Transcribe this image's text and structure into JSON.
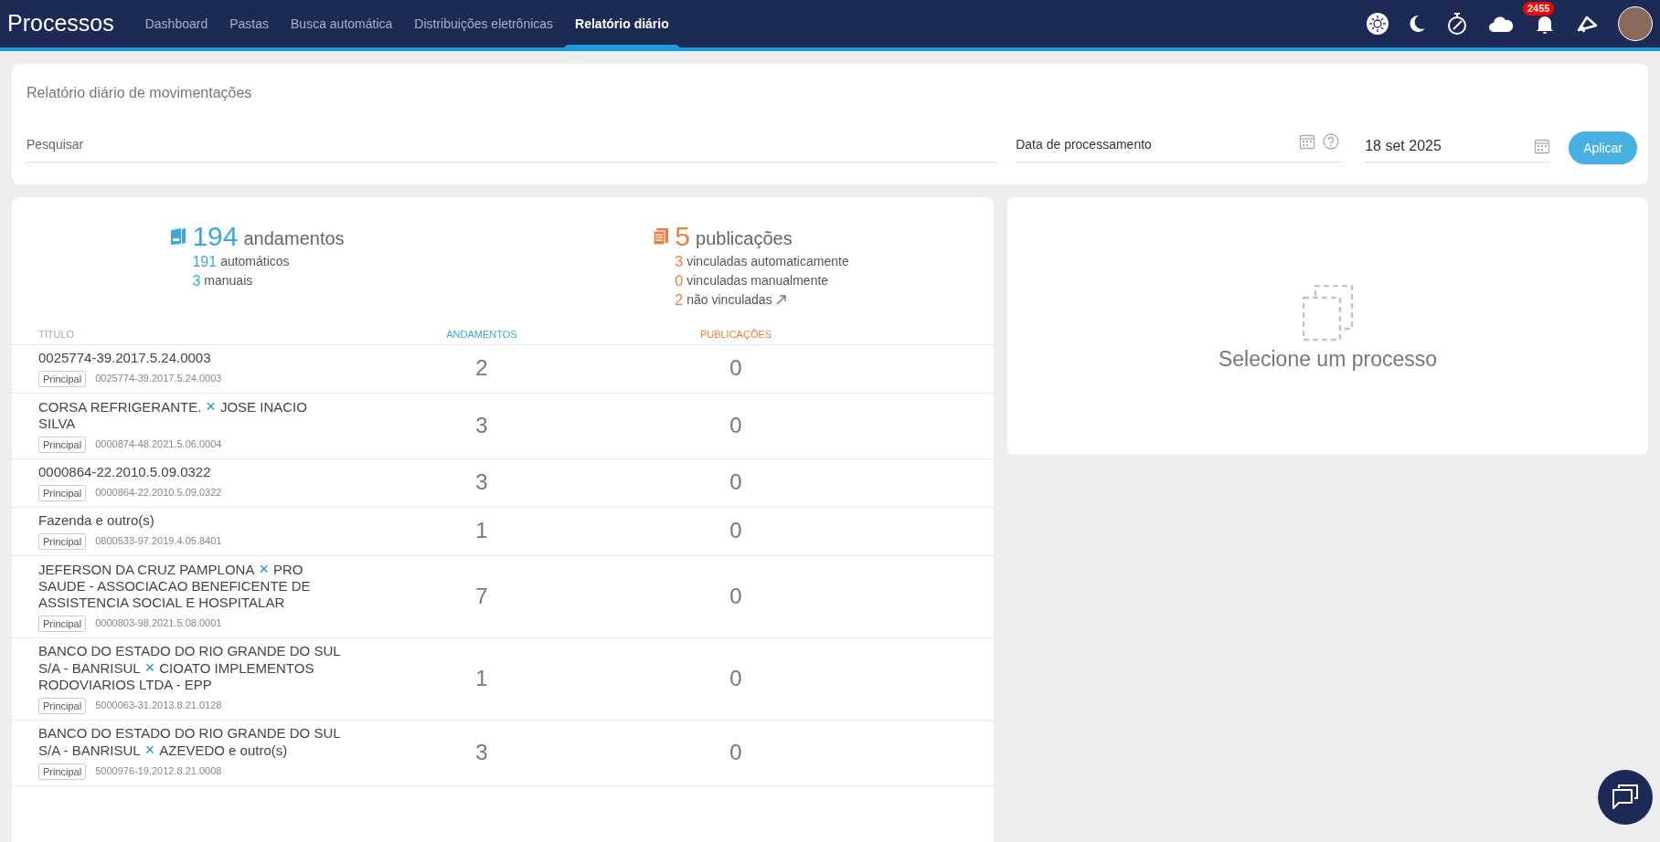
{
  "app_title": "Processos",
  "nav": [
    {
      "label": "Dashboard",
      "selected": false
    },
    {
      "label": "Pastas",
      "selected": false
    },
    {
      "label": "Busca automática",
      "selected": false
    },
    {
      "label": "Distribuições eletrônicas",
      "selected": false
    },
    {
      "label": "Relatório diário",
      "selected": true
    }
  ],
  "notifications_badge": "2455",
  "report": {
    "title": "Relatório diário de movimentações",
    "search": {
      "placeholder": "Pesquisar"
    },
    "date_field": {
      "placeholder": "Data de processamento"
    },
    "date_value": "18 set 2025",
    "apply_button": "Aplicar"
  },
  "summary": {
    "andamentos": {
      "count": "194",
      "label": "andamentos",
      "lines": [
        {
          "count": "191",
          "label": "automáticos"
        },
        {
          "count": "3",
          "label": "manuais"
        }
      ]
    },
    "publicacoes": {
      "count": "5",
      "label": "publicações",
      "lines": [
        {
          "count": "3",
          "label": "vinculadas automaticamente",
          "link": false
        },
        {
          "count": "0",
          "label": "vinculadas manualmente",
          "link": false
        },
        {
          "count": "2",
          "label": "não vinculadas",
          "link": true
        }
      ]
    }
  },
  "table": {
    "columns": [
      "TÍTULO",
      "ANDAMENTOS",
      "PUBLICAÇÕES"
    ],
    "separator": "×",
    "rows": [
      {
        "parties": [
          "0025774-39.2017.5.24.0003"
        ],
        "tag": "Principal",
        "number": "0025774-39.2017.5.24.0003",
        "andamentos": "2",
        "publicacoes": "0"
      },
      {
        "parties": [
          "CORSA REFRIGERANTE.",
          "JOSE INACIO SILVA"
        ],
        "tag": "Principal",
        "number": "0000874-48.2021.5.06.0004",
        "andamentos": "3",
        "publicacoes": "0"
      },
      {
        "parties": [
          "0000864-22.2010.5.09.0322"
        ],
        "tag": "Principal",
        "number": "0000864-22.2010.5.09.0322",
        "andamentos": "3",
        "publicacoes": "0"
      },
      {
        "parties": [
          "Fazenda e outro(s)"
        ],
        "tag": "Principal",
        "number": "0800533-97.2019.4.05.8401",
        "andamentos": "1",
        "publicacoes": "0"
      },
      {
        "parties": [
          "JEFERSON DA CRUZ PAMPLONA",
          "PRO SAUDE - ASSOCIACAO BENEFICENTE DE ASSISTENCIA SOCIAL E HOSPITALAR"
        ],
        "tag": "Principal",
        "number": "0000803-98.2021.5.08.0001",
        "andamentos": "7",
        "publicacoes": "0"
      },
      {
        "parties": [
          "BANCO DO ESTADO DO RIO GRANDE DO SUL S/A - BANRISUL",
          "CIOATO IMPLEMENTOS RODOVIARIOS LTDA - EPP"
        ],
        "tag": "Principal",
        "number": "5000063-31.2013.8.21.0128",
        "andamentos": "1",
        "publicacoes": "0"
      },
      {
        "parties": [
          "BANCO DO ESTADO DO RIO GRANDE DO SUL S/A - BANRISUL",
          "AZEVEDO e outro(s)"
        ],
        "tag": "Principal",
        "number": "5000976-19.2012.8.21.0008",
        "andamentos": "3",
        "publicacoes": "0"
      }
    ]
  },
  "detail": {
    "empty_message": "Selecione um processo"
  }
}
